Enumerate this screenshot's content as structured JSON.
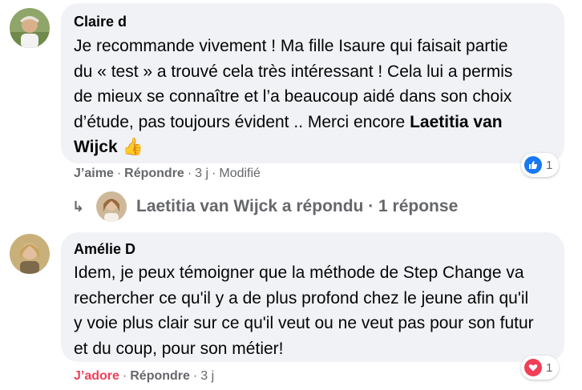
{
  "comments": [
    {
      "author": "Claire d",
      "text_before": "Je recommande vivement ! Ma fille Isaure qui faisait partie du « test » a trouvé cela très intéressant ! Cela lui a permis de mieux se connaître et l’a beaucoup aidé dans son choix d’étude, pas toujours évident .. Merci encore ",
      "mention": "Laetitia van Wijck",
      "emoji": "👍",
      "actions": {
        "react": "J’aime",
        "reply": "Répondre",
        "time": "3 j",
        "edited": "Modifié"
      },
      "reaction": {
        "icon": "like-icon",
        "count": "1",
        "color": "#1877f2"
      }
    },
    {
      "author": "Amélie D",
      "text": "Idem, je peux témoigner que la méthode de Step Change va rechercher ce qu'il y a de plus profond chez le jeune afin qu'il y voie plus clair sur ce qu'il veut ou ne veut pas pour son futur et du coup, pour son métier!",
      "actions": {
        "react": "J’adore",
        "reply": "Répondre",
        "time": "3 j"
      },
      "reaction": {
        "icon": "love-icon",
        "count": "1",
        "color": "#f33e58"
      }
    }
  ],
  "replies": {
    "summary": "Laetitia van Wijck a répondu · 1 réponse",
    "icon": "reply-arrow-icon"
  }
}
